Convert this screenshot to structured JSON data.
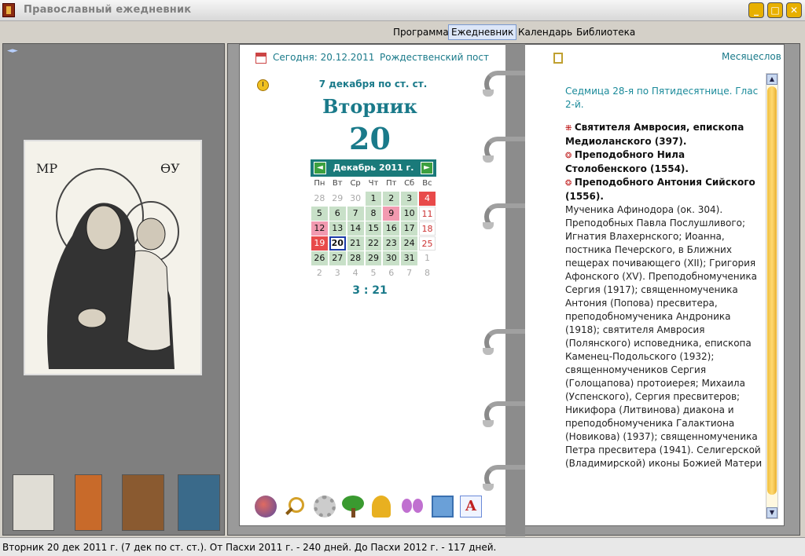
{
  "window": {
    "title": "Православный ежедневник"
  },
  "menu": {
    "program": "Программа",
    "diary": "Ежедневник",
    "calendar": "Календарь",
    "library": "Библиотека"
  },
  "left_page": {
    "today": "Сегодня: 20.12.2011",
    "post": "Рождественский пост",
    "old_style_date": "7 декабря по ст. ст.",
    "weekday": "Вторник",
    "day_number": "20",
    "time": "3 : 21"
  },
  "calendar": {
    "month_label": "Декабрь 2011 г.",
    "prev": "◄",
    "next": "►",
    "weekdays": [
      "Пн",
      "Вт",
      "Ср",
      "Чт",
      "Пт",
      "Сб",
      "Вс"
    ],
    "rows": [
      [
        {
          "d": "28",
          "t": "other"
        },
        {
          "d": "29",
          "t": "other"
        },
        {
          "d": "30",
          "t": "other"
        },
        {
          "d": "1",
          "t": "work"
        },
        {
          "d": "2",
          "t": "work"
        },
        {
          "d": "3",
          "t": "work"
        },
        {
          "d": "4",
          "t": "hol"
        }
      ],
      [
        {
          "d": "5",
          "t": "work"
        },
        {
          "d": "6",
          "t": "work"
        },
        {
          "d": "7",
          "t": "work"
        },
        {
          "d": "8",
          "t": "work"
        },
        {
          "d": "9",
          "t": "pink"
        },
        {
          "d": "10",
          "t": "work"
        },
        {
          "d": "11",
          "t": "sat"
        }
      ],
      [
        {
          "d": "12",
          "t": "pink"
        },
        {
          "d": "13",
          "t": "work"
        },
        {
          "d": "14",
          "t": "work"
        },
        {
          "d": "15",
          "t": "work"
        },
        {
          "d": "16",
          "t": "work"
        },
        {
          "d": "17",
          "t": "work"
        },
        {
          "d": "18",
          "t": "sat"
        }
      ],
      [
        {
          "d": "19",
          "t": "hol"
        },
        {
          "d": "20",
          "t": "today"
        },
        {
          "d": "21",
          "t": "work"
        },
        {
          "d": "22",
          "t": "work"
        },
        {
          "d": "23",
          "t": "work"
        },
        {
          "d": "24",
          "t": "work"
        },
        {
          "d": "25",
          "t": "sat"
        }
      ],
      [
        {
          "d": "26",
          "t": "work"
        },
        {
          "d": "27",
          "t": "work"
        },
        {
          "d": "28",
          "t": "work"
        },
        {
          "d": "29",
          "t": "work"
        },
        {
          "d": "30",
          "t": "work"
        },
        {
          "d": "31",
          "t": "work"
        },
        {
          "d": "1",
          "t": "other"
        }
      ],
      [
        {
          "d": "2",
          "t": "other"
        },
        {
          "d": "3",
          "t": "other"
        },
        {
          "d": "4",
          "t": "other"
        },
        {
          "d": "5",
          "t": "other"
        },
        {
          "d": "6",
          "t": "other"
        },
        {
          "d": "7",
          "t": "other"
        },
        {
          "d": "8",
          "t": "other"
        }
      ]
    ]
  },
  "right_page": {
    "menologion": "Месяцеслов",
    "week": "Седмица 28-я по Пятидесятнице. Глас 2-й.",
    "major_saints": [
      {
        "mark": "⁜",
        "text": "Святителя Амвросия, епископа Медиоланского (397)."
      },
      {
        "mark": "❂",
        "text": "Преподобного Нила Столобенского (1554)."
      },
      {
        "mark": "❂",
        "text": "Преподобного Антония Сийского (1556)."
      }
    ],
    "other_saints": "Мученика Афинодора (ок. 304). Преподобных Павла Послушливого; Игнатия Влахернского; Иоанна, постника Печерского, в Ближних пещерах почивающего (XII); Григория Афонского (XV). Преподобномученика Сергия (1917); священномученика Антония (Попова) пресвитера, преподобномученика Андроника (1918); святителя Амвросия (Полянского) исповедника, епископа Каменец-Подольского (1932); священномучеников Сергия (Голощапова) протоиерея; Михаила (Успенского), Сергия пресвитеров; Никифора (Литвинова) диакона и преподобномученика Галактиона (Новикова) (1937); священномученика Петра пресвитера (1941). Селигерской (Владимирской) иконы Божией Матери"
  },
  "status": "Вторник 20 дек 2011 г. (7 дек по ст. ст.). От Пасхи 2011 г. - 240 дней. До Пасхи 2012 г. - 117 дней.",
  "icon_labels": {
    "main_icon_left": "МР",
    "main_icon_right": "ѲУ"
  }
}
